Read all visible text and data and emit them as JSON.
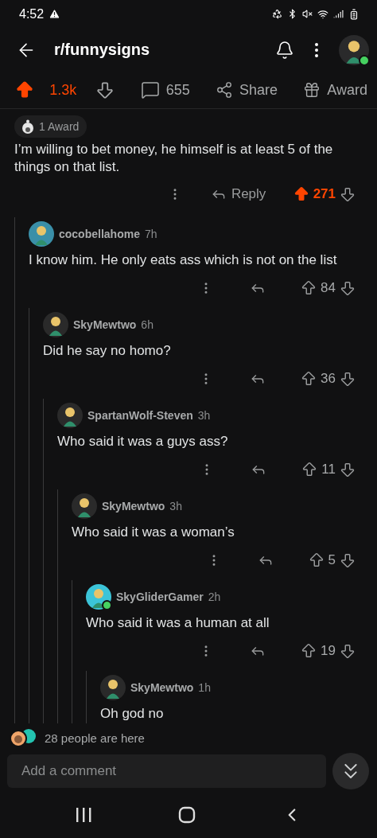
{
  "status_bar": {
    "time": "4:52"
  },
  "header": {
    "title": "r/funnysigns",
    "user_online": true
  },
  "post_bar": {
    "score": "1.3k",
    "upvoted": true,
    "comments": "655",
    "share": "Share",
    "award": "Award"
  },
  "comment": {
    "award": "1 Award",
    "body": "I’m willing to bet money, he himself is at least 5 of the things on that list.",
    "reply_label": "Reply",
    "score": "271",
    "upvoted": true,
    "children": [
      {
        "author": "cocobellahome",
        "time": "7h",
        "color": "#3a8fa8",
        "online": false,
        "body": "I know him. He only eats ass which is not on the list",
        "score": "84",
        "upvoted": false,
        "children": [
          {
            "author": "SkyMewtwo",
            "time": "6h",
            "color": "#2a2a2a",
            "online": false,
            "body": "Did he say no homo?",
            "score": "36",
            "upvoted": false,
            "children": [
              {
                "author": "SpartanWolf-Steven",
                "time": "3h",
                "color": "#2a2a2a",
                "online": false,
                "body": "Who said it was a guys ass?",
                "score": "11",
                "upvoted": false,
                "children": [
                  {
                    "author": "SkyMewtwo",
                    "time": "3h",
                    "color": "#2a2a2a",
                    "online": false,
                    "body": "Who said it was a woman’s",
                    "score": "5",
                    "upvoted": false,
                    "children": [
                      {
                        "author": "SkyGliderGamer",
                        "time": "2h",
                        "color": "#3cc4d8",
                        "online": true,
                        "body": "Who said it was a human at all",
                        "score": "19",
                        "upvoted": false,
                        "children": [
                          {
                            "author": "SkyMewtwo",
                            "time": "1h",
                            "color": "#2a2a2a",
                            "online": false,
                            "body": "Oh god no"
                          }
                        ]
                      }
                    ]
                  }
                ]
              }
            ]
          }
        ]
      }
    ]
  },
  "presence": {
    "text": "28 people are here"
  },
  "composer": {
    "placeholder": "Add a comment"
  }
}
